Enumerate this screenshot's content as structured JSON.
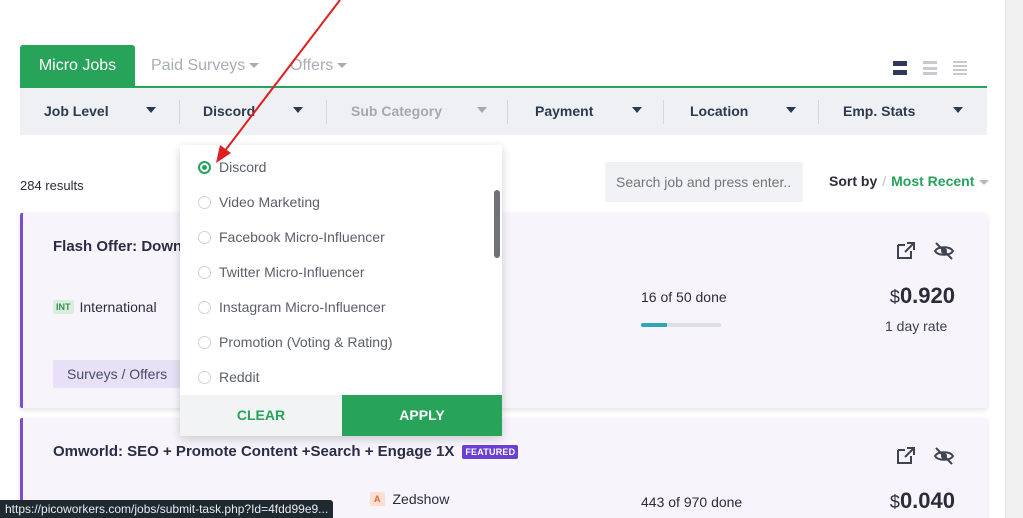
{
  "tabs": [
    {
      "label": "Micro Jobs",
      "active": true
    },
    {
      "label": "Paid Surveys",
      "active": false
    },
    {
      "label": "Offers",
      "active": false
    }
  ],
  "view_icons": [
    "grid-view-icon",
    "list-view-icon",
    "dense-list-view-icon"
  ],
  "filters": [
    {
      "label": "Job Level",
      "disabled": false
    },
    {
      "label": "Discord",
      "disabled": false
    },
    {
      "label": "Sub Category",
      "disabled": true
    },
    {
      "label": "Payment",
      "disabled": false
    },
    {
      "label": "Location",
      "disabled": false
    },
    {
      "label": "Emp. Stats",
      "disabled": false
    }
  ],
  "results_text": "284 results",
  "search": {
    "placeholder": "Search job and press enter..."
  },
  "sort": {
    "label": "Sort by",
    "separator": "/",
    "value": "Most Recent"
  },
  "dropdown": {
    "options": [
      {
        "label": "Discord",
        "checked": true
      },
      {
        "label": "Video Marketing",
        "checked": false
      },
      {
        "label": "Facebook Micro-Influencer",
        "checked": false
      },
      {
        "label": "Twitter Micro-Influencer",
        "checked": false
      },
      {
        "label": "Instagram Micro-Influencer",
        "checked": false
      },
      {
        "label": "Promotion (Voting & Rating)",
        "checked": false
      },
      {
        "label": "Reddit",
        "checked": false
      }
    ],
    "clear_label": "CLEAR",
    "apply_label": "APPLY"
  },
  "jobs": [
    {
      "title": "Flash Offer: Downl",
      "location_badge": "INT",
      "location": "International",
      "category": "Surveys / Offers",
      "done": "16",
      "of_word": "of",
      "total": "50",
      "done_word": "done",
      "progress": 0.32,
      "currency": "$",
      "price": "0.920",
      "rate": "1 day rate"
    },
    {
      "title": "Omworld: SEO + Promote Content +Search + Engage 1X",
      "featured": "FEATURED",
      "employer_badge": "A",
      "employer": "Zedshow",
      "done": "443",
      "of_word": "of",
      "total": "970",
      "done_word": "done",
      "currency": "$",
      "price": "0.040"
    }
  ],
  "status_url": "https://picoworkers.com/jobs/submit-task.php?Id=4fdd99e9...",
  "colors": {
    "accent": "#27a35a",
    "featured": "#6b3fd0",
    "annotation_arrow": "#e02020"
  }
}
